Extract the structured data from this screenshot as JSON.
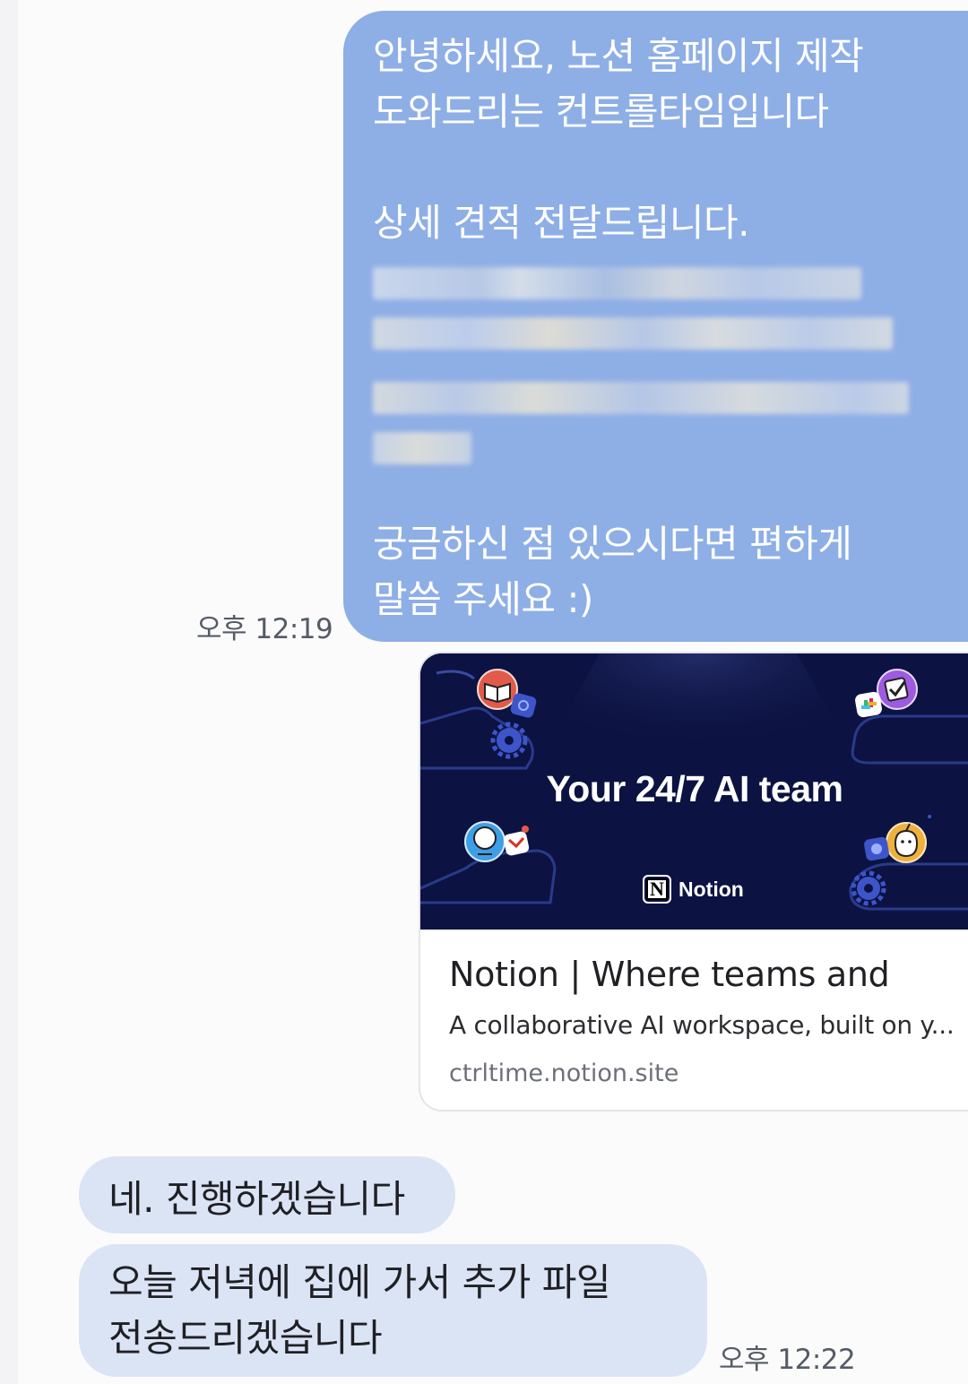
{
  "messages": {
    "outgoing": {
      "lines_top": [
        "안녕하세요, 노션 홈페이지 제작",
        "도와드리는 컨트롤타임입니다"
      ],
      "line_estimate": "상세 견적 전달드립니다.",
      "lines_bottom": [
        "궁금하신 점 있으시다면 편하게",
        "말씀 주세요 :)"
      ],
      "time": "오후 12:19"
    },
    "link_preview": {
      "hero_title": "Your 24/7 AI team",
      "hero_brand": "Notion",
      "hero_brand_logo": "N",
      "title": "Notion | Where teams and",
      "description": "A collaborative AI workspace, built on y...",
      "url": "ctrltime.notion.site"
    },
    "incoming": [
      {
        "lines": [
          "네. 진행하겠습니다"
        ]
      },
      {
        "lines": [
          "오늘 저녁에 집에 가서 추가 파일",
          "전송드리겠습니다"
        ]
      }
    ],
    "incoming_time": "오후 12:22"
  },
  "colors": {
    "outgoing_bubble": "#8eaee6",
    "incoming_bubble": "#dbe4f5",
    "hero_background": "#0c1342"
  },
  "icons": [
    "book-icon",
    "calendar-icon",
    "gear-icon",
    "checkmark-icon",
    "slack-icon",
    "globe-icon",
    "gmail-icon",
    "apple-icon",
    "pie-icon"
  ]
}
